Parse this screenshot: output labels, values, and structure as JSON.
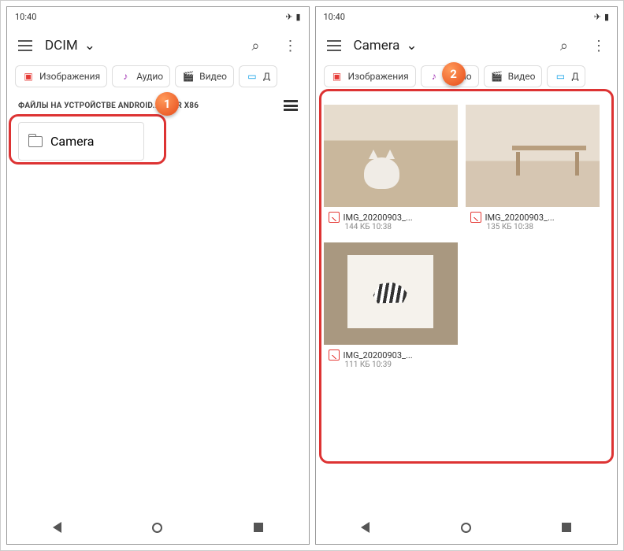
{
  "status": {
    "time": "10:40"
  },
  "chips": {
    "images": "Изображения",
    "audio": "Аудио",
    "video": "Видео",
    "docs_prefix": "Д"
  },
  "left": {
    "title": "DCIM",
    "section_label": "ФАЙЛЫ НА УСТРОЙСТВЕ ANDROID...T FOR X86",
    "folder": "Camera",
    "badge": "1"
  },
  "right": {
    "title": "Camera",
    "badge": "2",
    "thumbs": [
      {
        "name": "IMG_20200903_...",
        "meta": "144 КБ 10:38"
      },
      {
        "name": "IMG_20200903_...",
        "meta": "135 КБ 10:38"
      },
      {
        "name": "IMG_20200903_...",
        "meta": "111 КБ 10:39"
      }
    ]
  }
}
